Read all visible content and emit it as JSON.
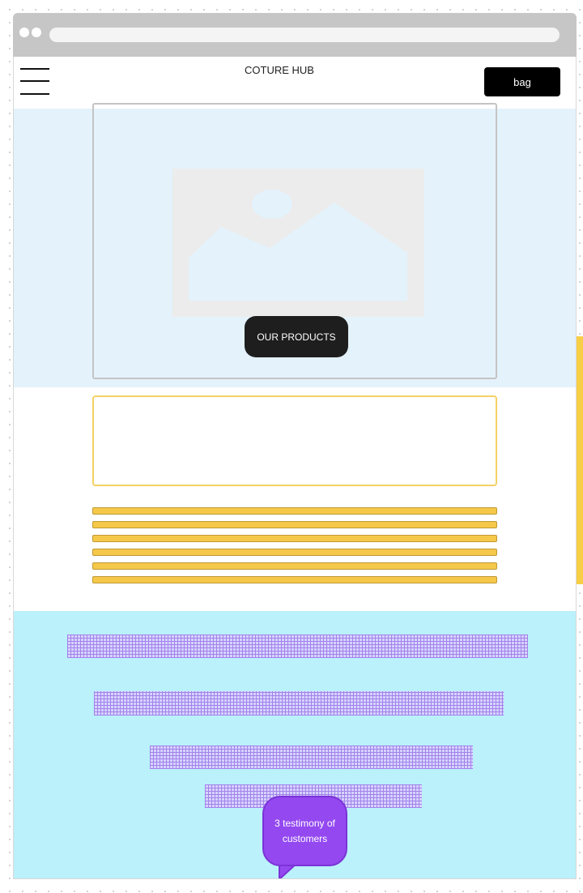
{
  "header": {
    "brand": "COTURE HUB",
    "menu_icon": "hamburger-menu-icon",
    "bag_label": "bag"
  },
  "hero": {
    "image_icon": "image-placeholder-icon",
    "products_button_label": "OUR PRODUCTS"
  },
  "about": {
    "text_line_count": 6
  },
  "testimonials": {
    "bubble_text": "3 testimony of customers",
    "hatch_color": "#a06ee8",
    "bubble_color": "#9449f0"
  },
  "colors": {
    "hero_bg": "#e4f2fc",
    "testimonial_bg": "#baf1fb",
    "accent_yellow": "#f5c84a",
    "button_dark": "#1e1e1e"
  }
}
